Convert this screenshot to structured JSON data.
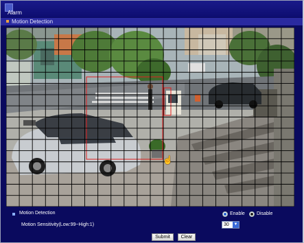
{
  "window": {
    "title": "Alarm"
  },
  "section": {
    "title": "Motion Detection"
  },
  "motion": {
    "label": "Motion Detection",
    "enable_label": "Enable",
    "disable_label": "Disable",
    "selected": "Disable"
  },
  "sensitivity": {
    "label": "Motion Sensitivity(Low:99~High:1)",
    "value": "30"
  },
  "buttons": {
    "submit": "Submit",
    "clear": "Clear"
  },
  "colors": {
    "title_bg": "#0d0d70",
    "grid_line": "#000000",
    "roi": "#e02020",
    "accent": "#2a2aa0"
  }
}
